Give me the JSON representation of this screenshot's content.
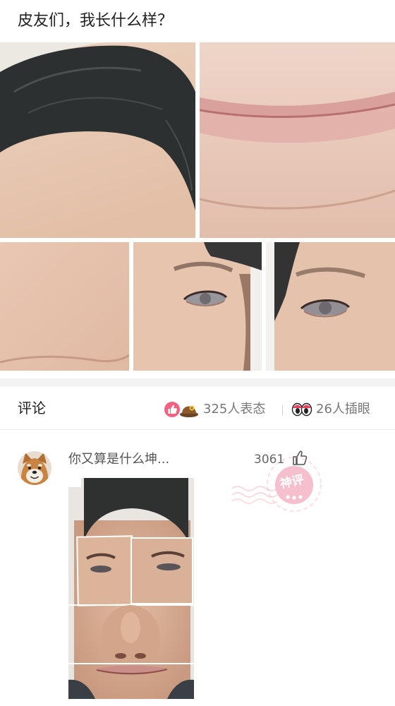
{
  "post": {
    "title": "皮友们，我长什么样？"
  },
  "comments_section": {
    "title": "评论",
    "reaction_summary": "325人表态",
    "eye_summary": "26人插眼"
  },
  "comment": {
    "text": "你又算是什么坤...",
    "likes": "3061",
    "badge": "神评"
  },
  "icons": {
    "reaction_primary": "thumb-up-icon",
    "reaction_secondary": "hat-icon",
    "eye_reaction": "eyes-icon",
    "comment_like": "thumb-up-outline-icon",
    "comment_badge": "god-comment-stamp-icon"
  },
  "colors": {
    "accent_pink": "#f4607f",
    "stamp_pink": "#f5b4c4",
    "text_primary": "#222222",
    "text_secondary": "#777777",
    "separator": "#f3f3f3"
  }
}
